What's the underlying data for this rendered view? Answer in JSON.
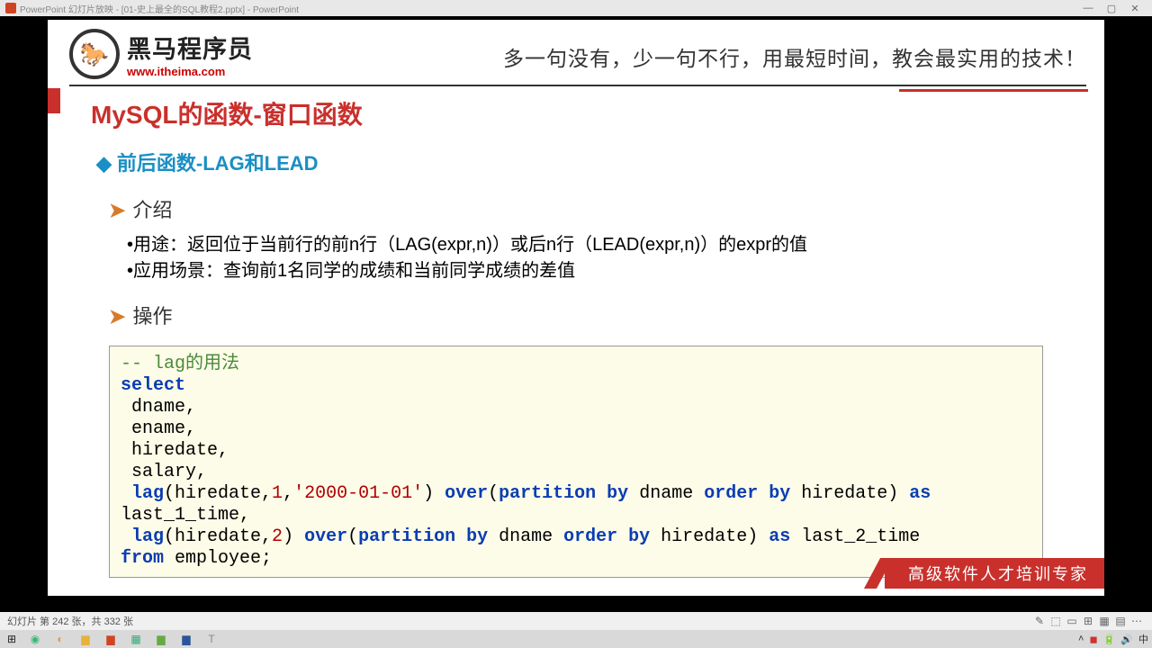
{
  "titlebar": {
    "text": "PowerPoint 幻灯片放映 - [01-史上最全的SQL教程2.pptx] - PowerPoint"
  },
  "logo": {
    "cn": "黑马程序员",
    "url": "www.itheima.com",
    "glyph": "🐎"
  },
  "tagline": "多一句没有，少一句不行，用最短时间，教会最实用的技术！",
  "title1": "MySQL的函数-窗口函数",
  "title2": "前后函数-LAG和LEAD",
  "sec_intro": "介绍",
  "sec_ops": "操作",
  "bullets": {
    "b1": "•用途：返回位于当前行的前n行（LAG(expr,n)）或后n行（LEAD(expr,n)）的expr的值",
    "b2": "•应用场景：查询前1名同学的成绩和当前同学成绩的差值"
  },
  "code": {
    "comment": "-- lag的用法",
    "kw_select": "select",
    "l_dname": " dname,",
    "l_ename": " ename,",
    "l_hiredate": " hiredate,",
    "l_salary": " salary,",
    "kw_lag1": " lag",
    "p1a": "(hiredate,",
    "n1": "1",
    "p1b": ",",
    "s1": "'2000-01-01'",
    "p1c": ") ",
    "kw_over1": "over",
    "p1d": "(",
    "kw_part1": "partition by",
    "p1e": " dname ",
    "kw_order1": "order by",
    "p1f": " hiredate) ",
    "kw_as1": "as",
    "l_last1": "last_1_time,",
    "kw_lag2": " lag",
    "p2a": "(hiredate,",
    "n2": "2",
    "p2b": ") ",
    "kw_over2": "over",
    "p2c": "(",
    "kw_part2": "partition by",
    "p2d": " dname ",
    "kw_order2": "order by",
    "p2e": " hiredate) ",
    "kw_as2": "as",
    "p2f": " last_2_time",
    "kw_from": "from",
    "l_employee": " employee;"
  },
  "footer_badge": "高级软件人才培训专家",
  "statusbar": {
    "text": "幻灯片 第 242 张，共 332 张"
  },
  "win_controls": {
    "min": "—",
    "max": "▢",
    "close": "✕"
  }
}
